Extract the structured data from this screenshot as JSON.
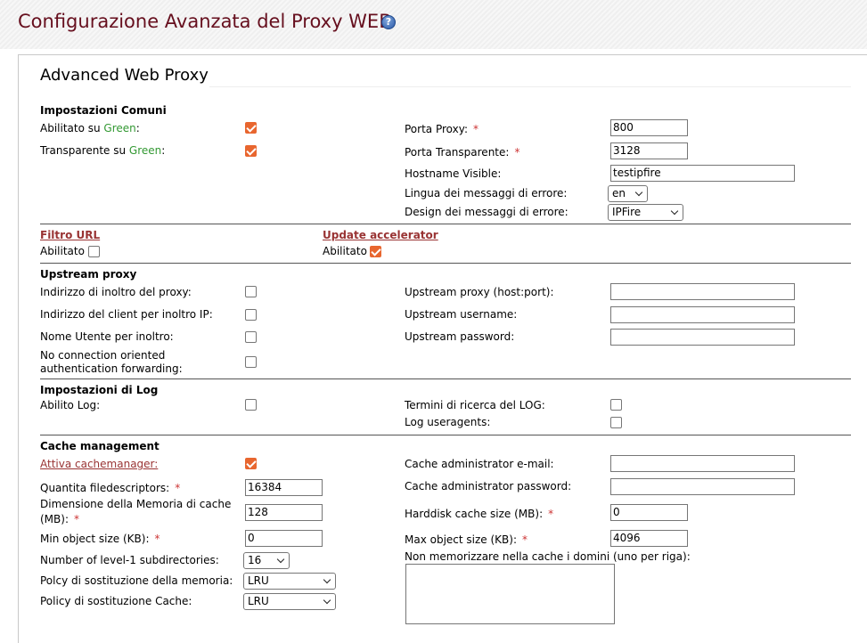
{
  "header": {
    "title": "Configurazione Avanzata del Proxy WEB",
    "help_glyph": "?"
  },
  "section_title": "Advanced Web Proxy",
  "common": {
    "heading": "Impostazioni Comuni",
    "enabled_green_prefix": "Abilitato su ",
    "green_word": "Green",
    "enabled_green_suffix": ":",
    "transparent_green_prefix": "Transparente su ",
    "transparent_green_suffix": ":",
    "enabled_green_checked": true,
    "transparent_green_checked": true,
    "proxy_port_label": "Porta Proxy:",
    "proxy_port_value": "800",
    "transparent_port_label": "Porta Transparente:",
    "transparent_port_value": "3128",
    "hostname_label": "Hostname Visible:",
    "hostname_value": "testipfire",
    "error_lang_label": "Lingua dei messaggi di errore:",
    "error_lang_value": "en",
    "error_design_label": "Design dei messaggi di errore:",
    "error_design_value": "IPFire",
    "required_mark": "*"
  },
  "url_filter": {
    "title": "Filtro URL",
    "enabled_label": "Abilitato",
    "checked": false
  },
  "update_accel": {
    "title": "Update accelerator",
    "enabled_label": "Abilitato",
    "checked": true
  },
  "upstream": {
    "heading": "Upstream proxy",
    "forward_proxy_addr_label": "Indirizzo di inoltro del proxy:",
    "forward_client_ip_label": "Indirizzo del client per inoltro IP:",
    "forward_username_label": "Nome Utente per inoltro:",
    "no_conn_auth_label_1": "No connection oriented",
    "no_conn_auth_label_2": "authentication forwarding:",
    "host_port_label": "Upstream proxy (host:port):",
    "username_label": "Upstream username:",
    "password_label": "Upstream password:",
    "host_port_value": "",
    "username_value": "",
    "password_value": ""
  },
  "log": {
    "heading": "Impostazioni di Log",
    "enabled_label": "Abilito Log:",
    "search_terms_label": "Termini di ricerca del LOG:",
    "useragents_label": "Log useragents:"
  },
  "cache": {
    "heading": "Cache management",
    "cachemanager_label": "Attiva cachemanager:",
    "cachemanager_checked": true,
    "filedescriptors_label": "Quantita filedescriptors:",
    "filedescriptors_value": "16384",
    "memory_label_1": "Dimensione della Memoria di cache",
    "memory_label_2": "(MB):",
    "memory_value": "128",
    "min_obj_label": "Min object size (KB):",
    "min_obj_value": "0",
    "l1_dirs_label": "Number of level-1 subdirectories:",
    "l1_dirs_value": "16",
    "mem_policy_label": "Polcy di sostituzione della memoria:",
    "mem_policy_value": "LRU",
    "cache_policy_label": "Policy di sostituzione Cache:",
    "cache_policy_value": "LRU",
    "admin_email_label": "Cache administrator e-mail:",
    "admin_email_value": "",
    "admin_password_label": "Cache administrator password:",
    "admin_password_value": "",
    "hdd_size_label": "Harddisk cache size (MB):",
    "hdd_size_value": "0",
    "max_obj_label": "Max object size (KB):",
    "max_obj_value": "4096",
    "no_cache_domains_label": "Non memorizzare nella cache i domini (uno per riga):"
  },
  "colors": {
    "title": "#660f1e",
    "checkbox_on": "#e8662f",
    "green": "#339933",
    "link": "#993333"
  }
}
